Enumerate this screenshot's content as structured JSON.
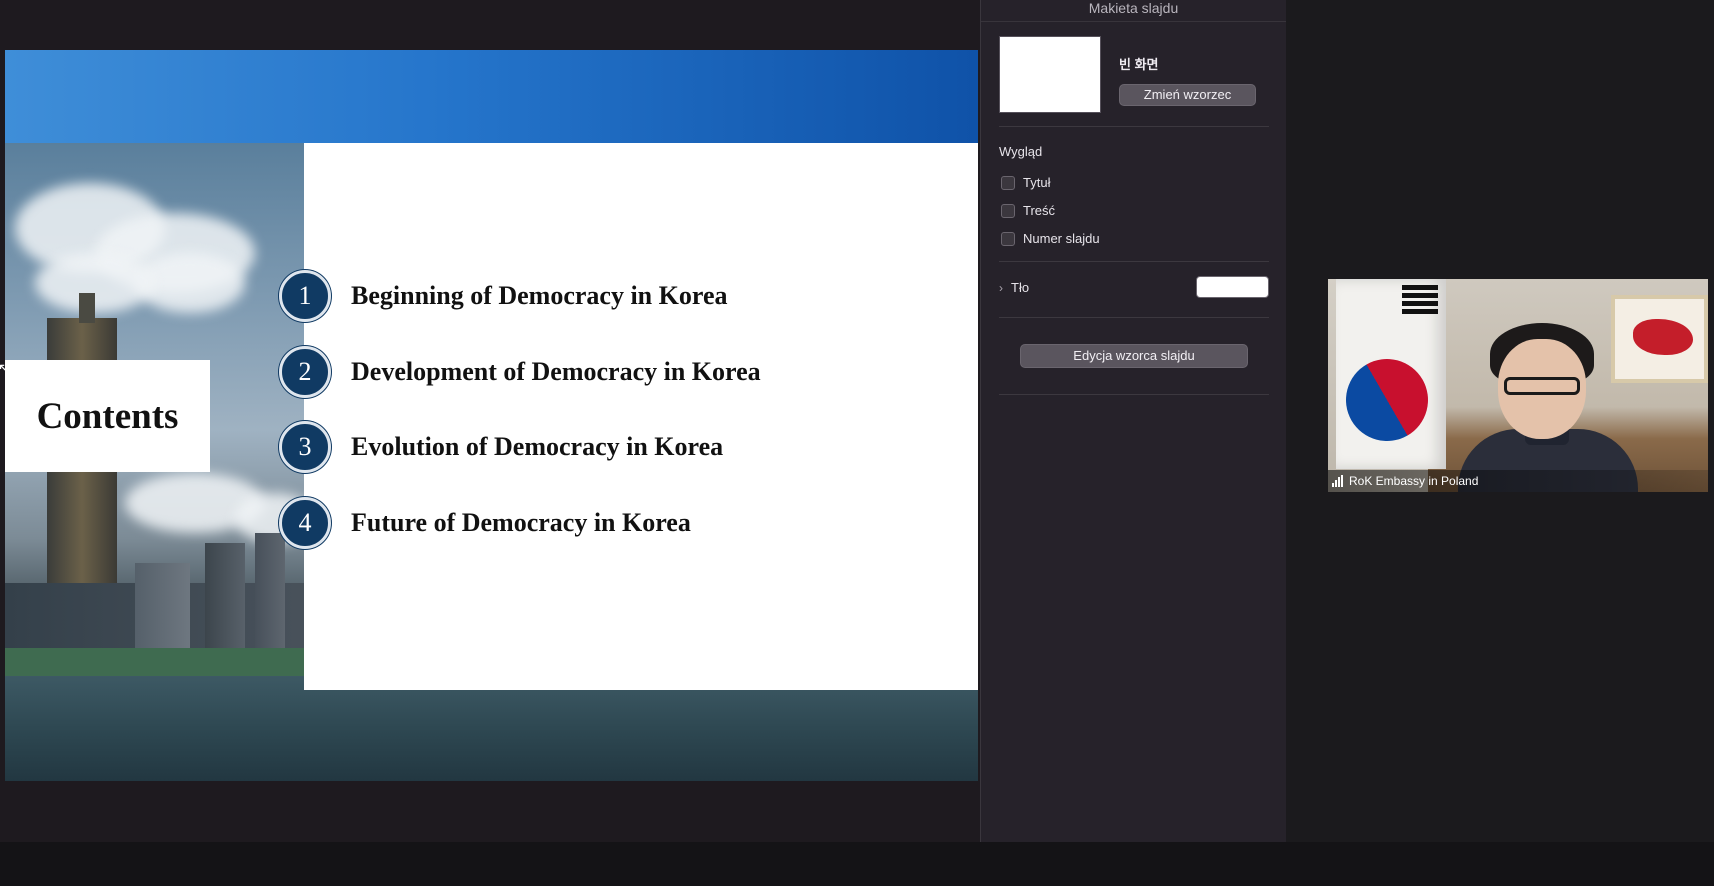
{
  "slide": {
    "contents_title": "Contents",
    "agenda": [
      {
        "number": "1",
        "text": "Beginning of Democracy in Korea"
      },
      {
        "number": "2",
        "text": "Development of Democracy in Korea"
      },
      {
        "number": "3",
        "text": "Evolution of Democracy in Korea"
      },
      {
        "number": "4",
        "text": "Future of Democracy in Korea"
      }
    ]
  },
  "panel": {
    "title": "Makieta slajdu",
    "layout_name": "빈 화면",
    "change_button": "Zmień wzorzec",
    "appearance_label": "Wygląd",
    "checkboxes": [
      {
        "label": "Tytuł",
        "checked": false
      },
      {
        "label": "Treść",
        "checked": false
      },
      {
        "label": "Numer slajdu",
        "checked": false
      }
    ],
    "background_label": "Tło",
    "background_color": "#ffffff",
    "edit_master_button": "Edycja wzorca slajdu"
  },
  "video": {
    "participant_name": "RoK Embassy in Poland"
  },
  "colors": {
    "slide_banner": "#2575cb",
    "agenda_circle": "#103a63",
    "panel_bg": "#26222a",
    "app_bg": "#1b1a1d"
  }
}
